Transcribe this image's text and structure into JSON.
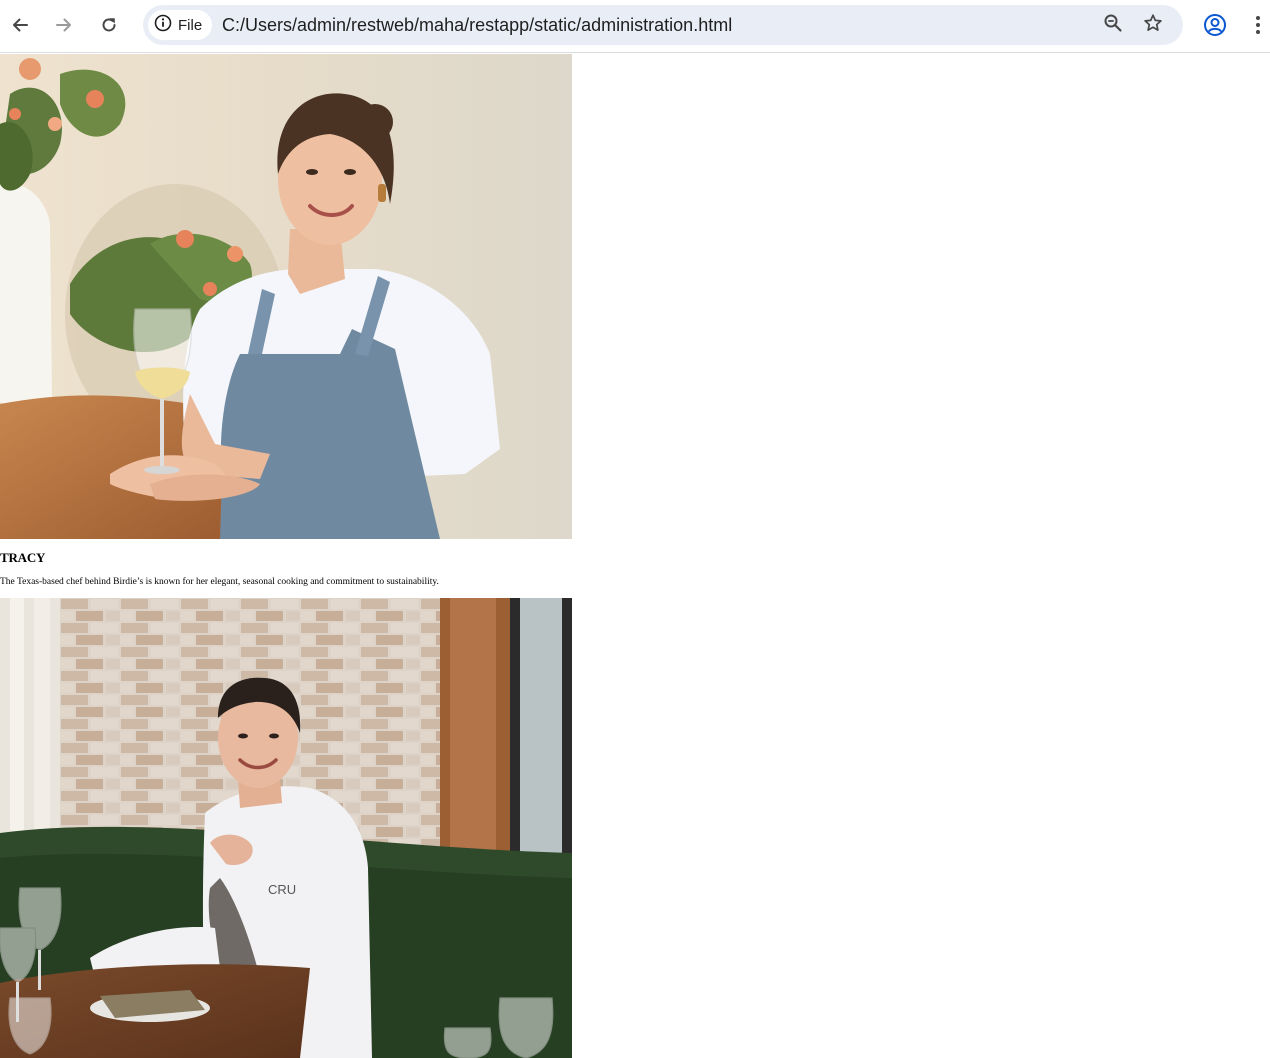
{
  "browser": {
    "site_info_label": "File",
    "url": "C:/Users/admin/restweb/maha/restapp/static/administration.html",
    "icons": {
      "back": "arrow-left-icon",
      "forward": "arrow-right-icon",
      "reload": "reload-icon",
      "site_info": "info-icon",
      "zoom": "zoom-out-icon",
      "bookmark": "star-icon",
      "profile": "profile-icon",
      "menu": "kebab-menu-icon"
    },
    "colors": {
      "omnibox_bg": "#e9eef6",
      "profile_accent": "#0b57d0"
    }
  },
  "chefs": [
    {
      "name": "TRACY",
      "description": "The Texas-based chef behind Birdie’s is known for her elegant, seasonal cooking and commitment to sustainability."
    },
    {
      "jacket_text": "CRU"
    }
  ]
}
